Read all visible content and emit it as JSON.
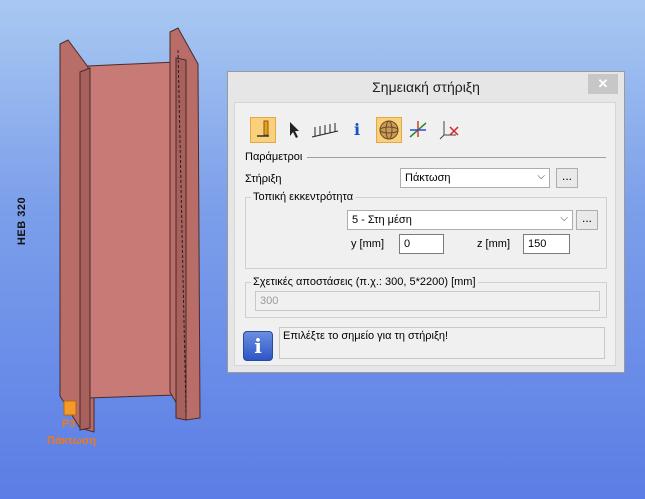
{
  "viewport": {
    "section_label": "HEB 320",
    "support_id": "P3",
    "support_type": "Πάκτωση",
    "background_top": "#a9c9f2",
    "background_bottom": "#5b7de6",
    "beam_color": "#c77a76"
  },
  "dialog": {
    "title": "Σημειακή στήριξη",
    "close_glyph": "✕",
    "toolbar": {
      "tools": [
        {
          "icon": "point-support-icon",
          "active": true
        },
        {
          "icon": "select-pointer-icon",
          "active": false
        },
        {
          "icon": "distributed-support-icon",
          "active": false
        },
        {
          "icon": "info-icon",
          "glyph": "i",
          "active": false
        },
        {
          "icon": "sphere-view-icon",
          "active": true
        },
        {
          "icon": "local-axes-icon",
          "active": false
        },
        {
          "icon": "delete-support-icon",
          "active": false
        }
      ]
    },
    "parameters_label": "Παράμετροι",
    "support": {
      "label": "Στήριξη",
      "value": "Πάκτωση",
      "more_button": "..."
    },
    "eccentricity": {
      "group_title": "Τοπική εκκεντρότητα",
      "value": "5 - Στη μέση",
      "more_button": "...",
      "y_label": "y [mm]",
      "y_value": "0",
      "z_label": "z [mm]",
      "z_value": "150"
    },
    "distances": {
      "group_title": "Σχετικές αποστάσεις (π.χ.: 300, 5*2200) [mm]",
      "value": "300"
    },
    "info": {
      "icon_glyph": "i",
      "message": "Επιλέξτε το σημείο για τη στήριξη!"
    },
    "accent_color": "#fbd07a"
  }
}
